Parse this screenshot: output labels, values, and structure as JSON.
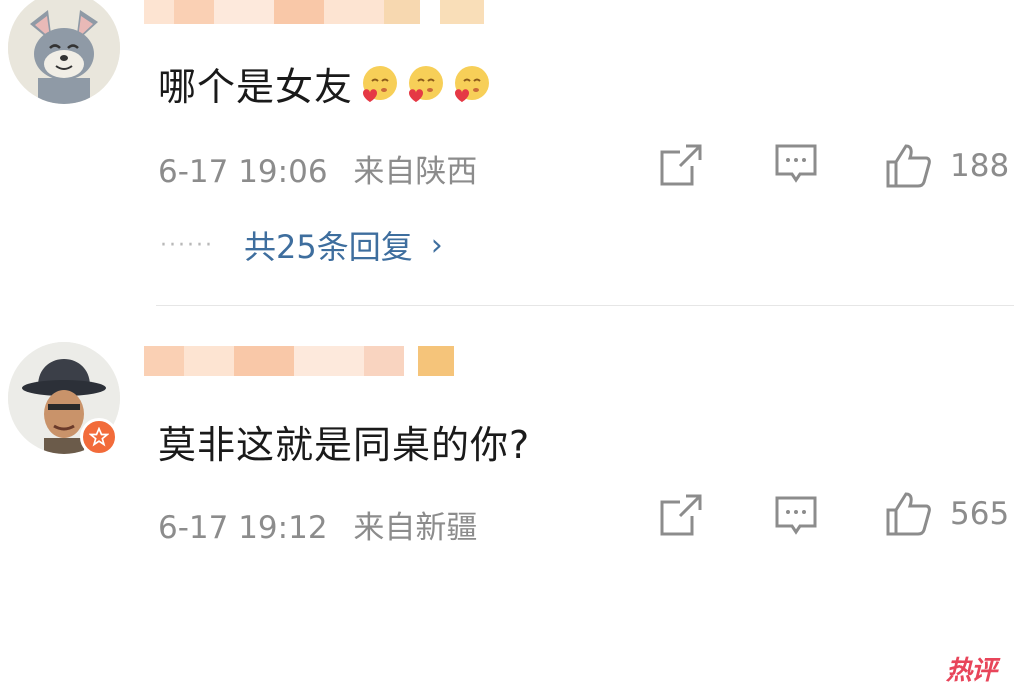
{
  "comments": [
    {
      "text": "哪个是女友",
      "emoji_count": 3,
      "emoji_icon": "smiling-heart-emoji",
      "time": "6-17 19:06",
      "location": "来自陕西",
      "likes": "188",
      "replies_text": "共25条回复",
      "replies_dots": "······",
      "avatar_icon": "cartoon-cat-avatar"
    },
    {
      "text": "莫非这就是同桌的你?",
      "time": "6-17 19:12",
      "location": "来自新疆",
      "likes": "565",
      "badge": "热评",
      "avatar_icon": "hat-man-avatar",
      "verified_icon": "star-badge-icon"
    }
  ],
  "colors": {
    "link": "#3e6e9e",
    "meta": "#8c8c8c",
    "hot_badge": "#e8455a",
    "verified": "#f26b3a"
  }
}
